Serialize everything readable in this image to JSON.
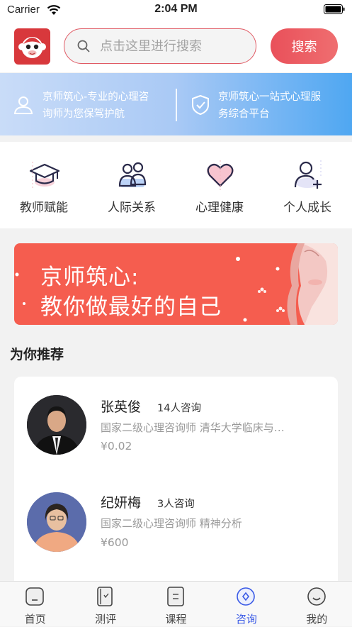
{
  "status_bar": {
    "carrier": "Carrier",
    "time": "2:04 PM"
  },
  "search": {
    "placeholder": "点击这里进行搜索",
    "button_label": "搜索"
  },
  "banner": {
    "left_lines": [
      "京师筑心-专业的心理咨",
      "询师为您保驾护航"
    ],
    "right_lines": [
      "京师筑心一站式心理服",
      "务综合平台"
    ]
  },
  "categories": [
    {
      "label": "教师赋能",
      "icon": "graduation-cap-icon"
    },
    {
      "label": "人际关系",
      "icon": "people-icon"
    },
    {
      "label": "心理健康",
      "icon": "heart-icon"
    },
    {
      "label": "个人成长",
      "icon": "person-add-icon"
    }
  ],
  "promo": {
    "line1": "京师筑心:",
    "line2": "教你做最好的自己"
  },
  "recommend": {
    "title": "为你推荐",
    "counselors": [
      {
        "name": "张英俊",
        "consults": "14人咨询",
        "desc": "国家二级心理咨询师  清华大学临床与…",
        "price": "¥0.02"
      },
      {
        "name": "纪妍梅",
        "consults": "3人咨询",
        "desc": "国家二级心理咨询师  精神分析",
        "price": "¥600"
      }
    ]
  },
  "tabbar": [
    {
      "label": "首页",
      "icon": "home-icon",
      "active": false
    },
    {
      "label": "测评",
      "icon": "assessment-icon",
      "active": false
    },
    {
      "label": "课程",
      "icon": "course-icon",
      "active": false
    },
    {
      "label": "咨询",
      "icon": "consult-icon",
      "active": true
    },
    {
      "label": "我的",
      "icon": "profile-icon",
      "active": false
    }
  ],
  "colors": {
    "accent": "#e9505a",
    "tab_active": "#3a5ae6",
    "promo_bg": "#f55d4f"
  }
}
